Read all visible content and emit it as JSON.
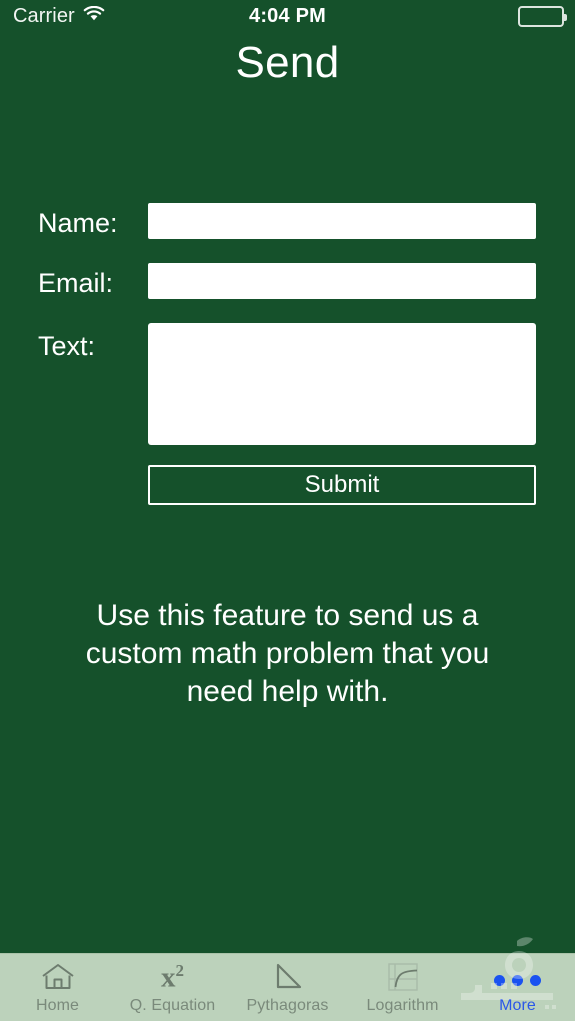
{
  "status_bar": {
    "carrier": "Carrier",
    "wifi_icon": "wifi-icon",
    "time": "4:04 PM",
    "battery_icon": "battery-full-icon"
  },
  "header": {
    "title": "Send"
  },
  "form": {
    "name": {
      "label": "Name:",
      "value": "",
      "placeholder": ""
    },
    "email": {
      "label": "Email:",
      "value": "",
      "placeholder": ""
    },
    "text": {
      "label": "Text:",
      "value": "",
      "placeholder": ""
    },
    "submit_label": "Submit"
  },
  "description": "Use this feature to send us a custom math problem that you need help with.",
  "tabbar": {
    "items": [
      {
        "label": "Home",
        "icon": "house-icon",
        "active": false
      },
      {
        "label": "Q. Equation",
        "icon": "x-squared-icon",
        "active": false
      },
      {
        "label": "Pythagoras",
        "icon": "right-triangle-icon",
        "active": false
      },
      {
        "label": "Logarithm",
        "icon": "log-curve-graph-icon",
        "active": false
      },
      {
        "label": "More",
        "icon": "three-dots-icon",
        "active": true
      }
    ]
  },
  "colors": {
    "background": "#15512b",
    "text": "#ffffff",
    "field_background": "#ffffff",
    "tabbar_background": "#bcd2bb",
    "tab_inactive": "#7a8a7b",
    "tab_active": "#2a57e8"
  }
}
